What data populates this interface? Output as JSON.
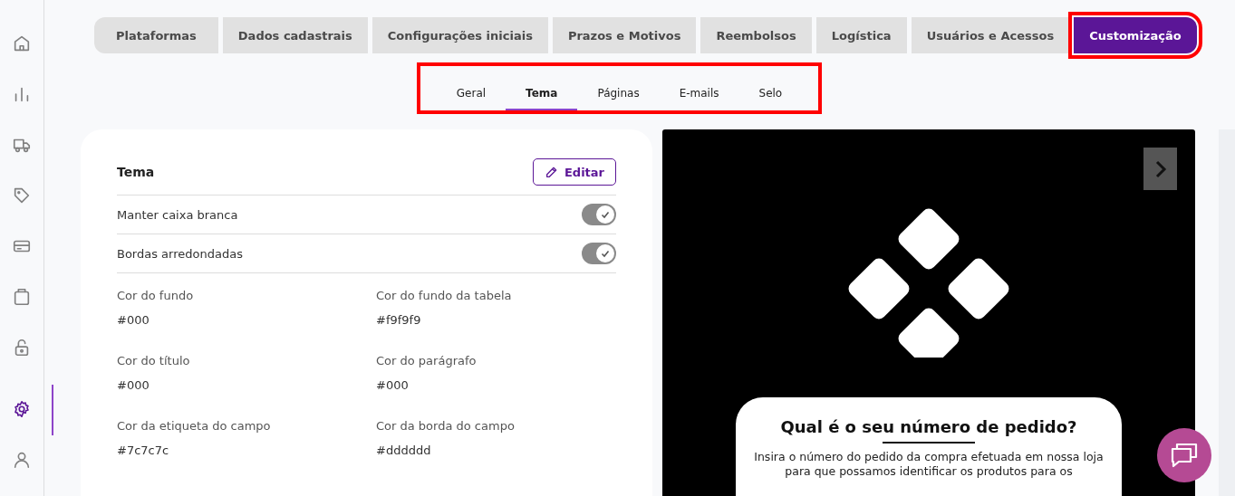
{
  "sidebar": {
    "items": [
      {
        "selected": false
      },
      {
        "selected": false
      },
      {
        "selected": false
      },
      {
        "selected": false
      },
      {
        "selected": false
      },
      {
        "selected": false
      },
      {
        "selected": false
      },
      {
        "selected": true
      },
      {
        "selected": false
      }
    ]
  },
  "tabs": [
    {
      "label": "Plataformas",
      "selected": false,
      "highlighted": false
    },
    {
      "label": "Dados cadastrais",
      "selected": false,
      "highlighted": false
    },
    {
      "label": "Configurações iniciais",
      "selected": false,
      "highlighted": false
    },
    {
      "label": "Prazos e Motivos",
      "selected": false,
      "highlighted": false
    },
    {
      "label": "Reembolsos",
      "selected": false,
      "highlighted": false
    },
    {
      "label": "Logística",
      "selected": false,
      "highlighted": false
    },
    {
      "label": "Usuários e Acessos",
      "selected": false,
      "highlighted": false
    },
    {
      "label": "Customização",
      "selected": true,
      "highlighted": true
    }
  ],
  "subtabs": {
    "highlighted": true,
    "items": [
      {
        "label": "Geral",
        "selected": false
      },
      {
        "label": "Tema",
        "selected": true
      },
      {
        "label": "Páginas",
        "selected": false
      },
      {
        "label": "E-mails",
        "selected": false
      },
      {
        "label": "Selo",
        "selected": false
      }
    ]
  },
  "theme_card": {
    "title": "Tema",
    "edit_button": "Editar",
    "toggles": [
      {
        "label": "Manter caixa branca",
        "on": true
      },
      {
        "label": "Bordas arredondadas",
        "on": true
      }
    ],
    "colors": [
      {
        "label": "Cor do fundo",
        "value": "#000"
      },
      {
        "label": "Cor do fundo da tabela",
        "value": "#f9f9f9"
      },
      {
        "label": "Cor do título",
        "value": "#000"
      },
      {
        "label": "Cor do parágrafo",
        "value": "#000"
      },
      {
        "label": "Cor da etiqueta do campo",
        "value": "#7c7c7c"
      },
      {
        "label": "Cor da borda do campo",
        "value": "#dddddd"
      }
    ]
  },
  "preview": {
    "heading": "Qual é o seu número de pedido?",
    "paragraph": "Insira o número do pedido da compra efetuada em nossa loja para que possamos identificar os produtos para os"
  }
}
